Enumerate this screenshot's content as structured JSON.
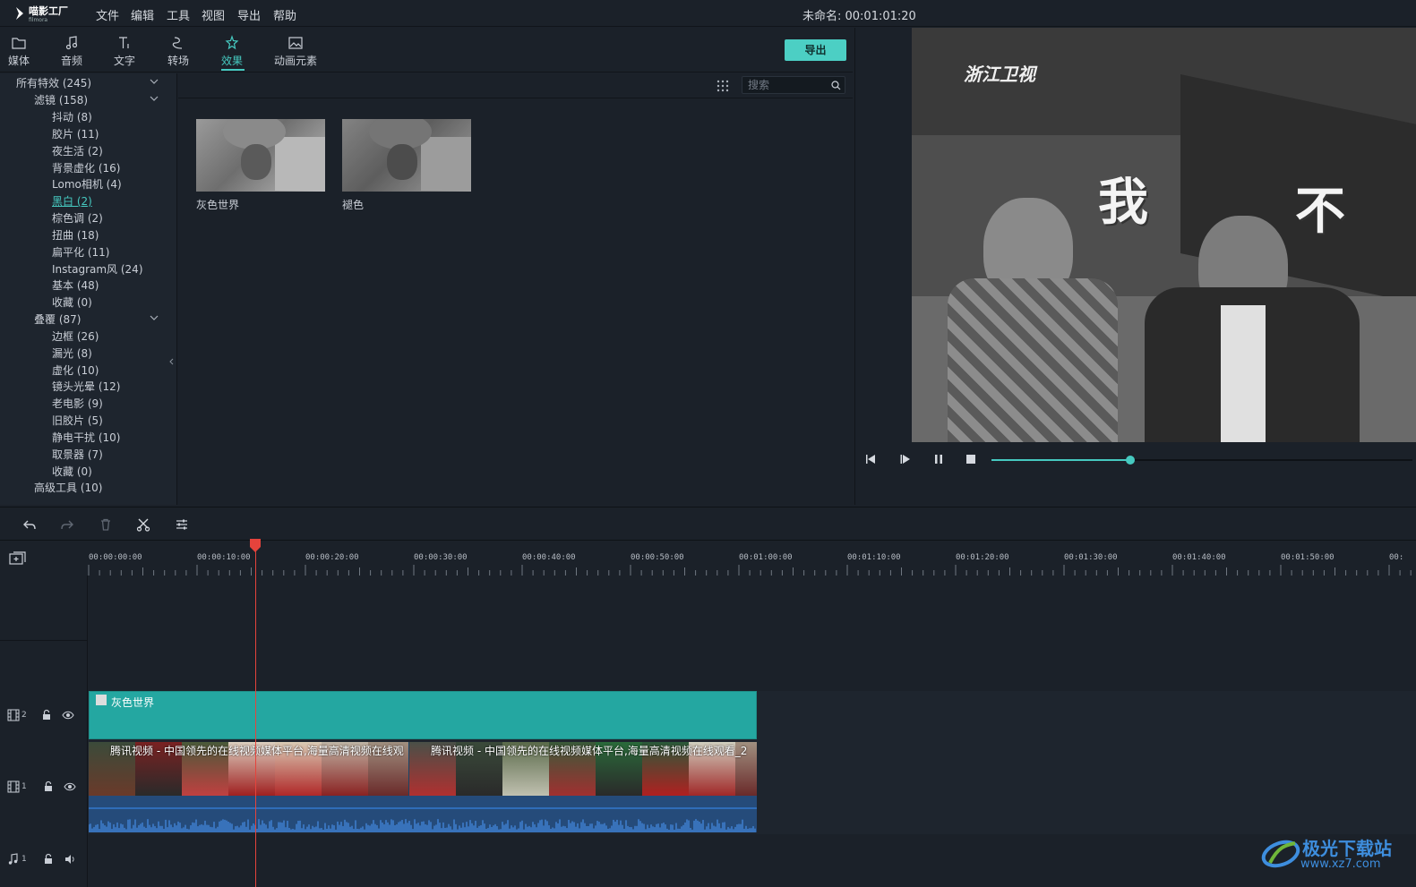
{
  "app": {
    "logo_name": "喵影工厂",
    "logo_sub": "filmora",
    "document_title": "未命名: 00:01:01:20"
  },
  "menu": [
    "文件",
    "编辑",
    "工具",
    "视图",
    "导出",
    "帮助"
  ],
  "tool_tabs": [
    {
      "label": "媒体",
      "icon": "folder-icon"
    },
    {
      "label": "音频",
      "icon": "music-note-icon"
    },
    {
      "label": "文字",
      "icon": "text-icon"
    },
    {
      "label": "转场",
      "icon": "transition-icon"
    },
    {
      "label": "效果",
      "icon": "effects-icon",
      "active": true
    },
    {
      "label": "动画元素",
      "icon": "image-icon"
    }
  ],
  "export_button": "导出",
  "effects_tree": {
    "items": [
      {
        "label": "所有特效 (245)",
        "level": 0,
        "expanded": true
      },
      {
        "label": "滤镜 (158)",
        "level": 1,
        "expanded": true
      },
      {
        "label": "抖动 (8)",
        "level": 2
      },
      {
        "label": "胶片 (11)",
        "level": 2
      },
      {
        "label": "夜生活 (2)",
        "level": 2
      },
      {
        "label": "背景虚化 (16)",
        "level": 2
      },
      {
        "label": "Lomo相机 (4)",
        "level": 2
      },
      {
        "label": "黑白 (2)",
        "level": 2,
        "selected": true
      },
      {
        "label": "棕色调 (2)",
        "level": 2
      },
      {
        "label": "扭曲 (18)",
        "level": 2
      },
      {
        "label": "扁平化 (11)",
        "level": 2
      },
      {
        "label": "Instagram风 (24)",
        "level": 2
      },
      {
        "label": "基本 (48)",
        "level": 2
      },
      {
        "label": "收藏 (0)",
        "level": 2
      },
      {
        "label": "叠覆 (87)",
        "level": 1,
        "expanded": true
      },
      {
        "label": "边框 (26)",
        "level": 2
      },
      {
        "label": "漏光 (8)",
        "level": 2
      },
      {
        "label": "虚化 (10)",
        "level": 2
      },
      {
        "label": "镜头光晕 (12)",
        "level": 2
      },
      {
        "label": "老电影 (9)",
        "level": 2
      },
      {
        "label": "旧胶片 (5)",
        "level": 2
      },
      {
        "label": "静电干扰 (10)",
        "level": 2
      },
      {
        "label": "取景器 (7)",
        "level": 2
      },
      {
        "label": "收藏 (0)",
        "level": 2
      },
      {
        "label": "高级工具 (10)",
        "level": 1
      }
    ]
  },
  "search": {
    "placeholder": "搜索"
  },
  "effects": [
    {
      "label": "灰色世界"
    },
    {
      "label": "褪色"
    }
  ],
  "player": {
    "progress": 0.33,
    "video_overlay_text": [
      "浙江卫视",
      "我",
      "不"
    ]
  },
  "timeline": {
    "ruler_labels": [
      "00:00:00:00",
      "00:00:10:00",
      "00:00:20:00",
      "00:00:30:00",
      "00:00:40:00",
      "00:00:50:00",
      "00:01:00:00",
      "00:01:10:00",
      "00:01:20:00",
      "00:01:30:00",
      "00:01:40:00",
      "00:01:50:00",
      "00:"
    ],
    "tracks": [
      {
        "type": "video",
        "number": "2"
      },
      {
        "type": "video",
        "number": "1"
      },
      {
        "type": "audio",
        "number": "1"
      }
    ],
    "fx_clip_label": "灰色世界",
    "video_clip_titles": [
      "腾讯视频 - 中国领先的在线视频媒体平台,海量高清视频在线观",
      "腾讯视频 - 中国领先的在线视频媒体平台,海量高清视频在线观看_2"
    ]
  },
  "watermark": {
    "line1": "极光下载站",
    "line2": "www.xz7.com"
  },
  "colors": {
    "accent": "#46c9c0",
    "fx_clip": "#24a7a1",
    "playhead": "#e5433c",
    "waveform": "#3f7fd0"
  }
}
